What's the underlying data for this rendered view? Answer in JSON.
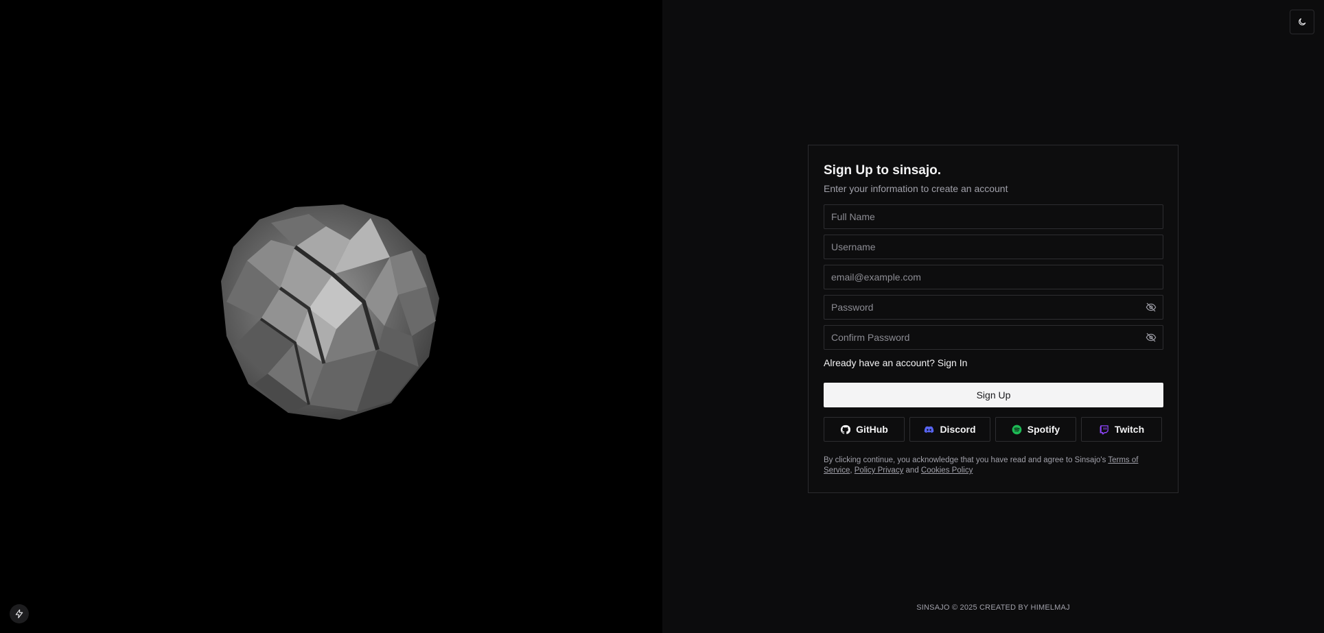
{
  "theme_toggle": {
    "icon": "moon-icon"
  },
  "hero": {
    "icon": "polyhedron-sphere"
  },
  "corner_button": {
    "icon": "bolt-icon"
  },
  "signup": {
    "title": "Sign Up to sinsajo.",
    "subtitle": "Enter your information to create an account",
    "fields": {
      "full_name": {
        "placeholder": "Full Name",
        "value": ""
      },
      "username": {
        "placeholder": "Username",
        "value": ""
      },
      "email": {
        "placeholder": "email@example.com",
        "value": ""
      },
      "password": {
        "placeholder": "Password",
        "value": ""
      },
      "confirm_password": {
        "placeholder": "Confirm Password",
        "value": ""
      }
    },
    "signin_link": "Already have an account? Sign In",
    "submit_label": "Sign Up",
    "social": {
      "github": "GitHub",
      "discord": "Discord",
      "spotify": "Spotify",
      "twitch": "Twitch"
    },
    "legal": {
      "prefix": "By clicking continue, you acknowledge that you have read and agree to Sinsajo's ",
      "terms": "Terms of Service",
      "sep1": ", ",
      "privacy": "Policy Privacy",
      "sep2": " and ",
      "cookies": "Cookies Policy"
    }
  },
  "footer": {
    "text": "SINSAJO © 2025 CREATED BY HIMELMAJ"
  },
  "colors": {
    "background_left": "#000000",
    "background_right": "#0c0c0d",
    "primary_button": "#f4f4f5",
    "discord": "#5865F2",
    "spotify": "#1DB954",
    "twitch": "#9146FF"
  }
}
